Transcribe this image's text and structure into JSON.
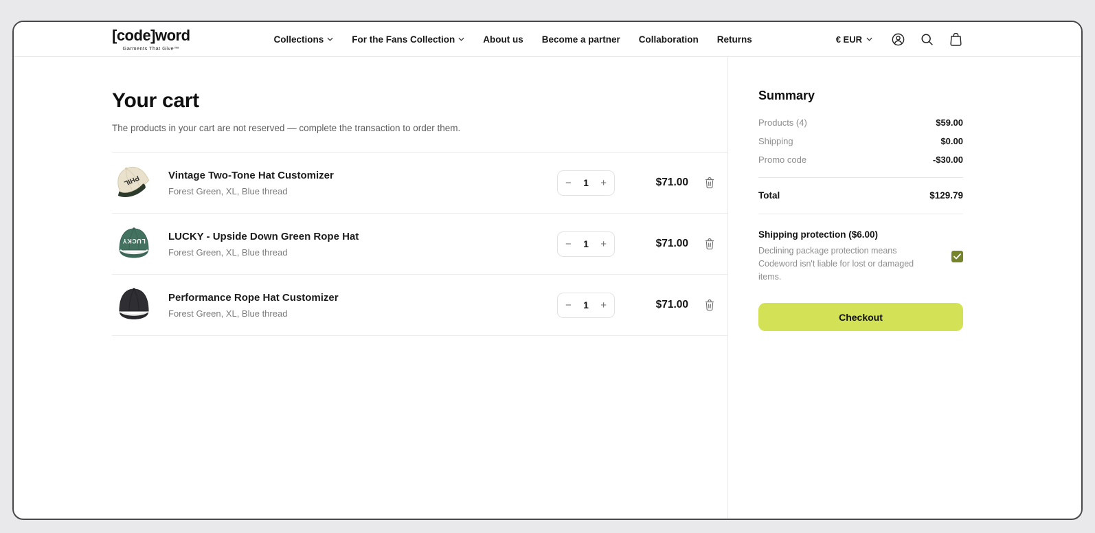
{
  "brand": {
    "name": "[code]word",
    "tagline": "Garments That Give™"
  },
  "nav": [
    {
      "label": "Collections",
      "dropdown": true
    },
    {
      "label": "For the Fans Collection",
      "dropdown": true
    },
    {
      "label": "About us",
      "dropdown": false
    },
    {
      "label": "Become a partner",
      "dropdown": false
    },
    {
      "label": "Collaboration",
      "dropdown": false
    },
    {
      "label": "Returns",
      "dropdown": false
    }
  ],
  "header": {
    "currency": "€ EUR",
    "icons": [
      "account-icon",
      "search-icon",
      "cart-bag-icon"
    ]
  },
  "cart": {
    "title": "Your cart",
    "subtitle": "The products in your cart are not reserved — complete the transaction to order them.",
    "stepper": {
      "decrease": "−",
      "increase": "+"
    },
    "items": [
      {
        "name": "Vintage Two-Tone Hat Customizer",
        "variant": "Forest Green, XL, Blue thread",
        "qty": "1",
        "price": "$71.00",
        "image": "vintage-two-tone-hat"
      },
      {
        "name": "LUCKY - Upside Down Green Rope Hat",
        "variant": "Forest Green, XL, Blue thread",
        "qty": "1",
        "price": "$71.00",
        "image": "lucky-green-rope-hat"
      },
      {
        "name": "Performance Rope Hat Customizer",
        "variant": "Forest Green, XL, Blue thread",
        "qty": "1",
        "price": "$71.00",
        "image": "performance-rope-hat"
      }
    ]
  },
  "summary": {
    "title": "Summary",
    "rows": [
      {
        "label": "Products (4)",
        "value": "$59.00"
      },
      {
        "label": "Shipping",
        "value": "$0.00"
      },
      {
        "label": "Promo code",
        "value": "-$30.00"
      }
    ],
    "total_label": "Total",
    "total_value": "$129.79",
    "shipping_protection": {
      "title": "Shipping protection ($6.00)",
      "description": "Declining package protection means Codeword isn't liable for lost or damaged items.",
      "checked": true
    },
    "checkout_label": "Checkout"
  },
  "colors": {
    "accent_lime": "#d3e156",
    "checkbox_olive": "#76852c",
    "page_background": "#e9e9eb",
    "hat_cream": "#e9e1cb",
    "hat_forest_green": "#447261",
    "hat_black": "#2f2f33"
  }
}
